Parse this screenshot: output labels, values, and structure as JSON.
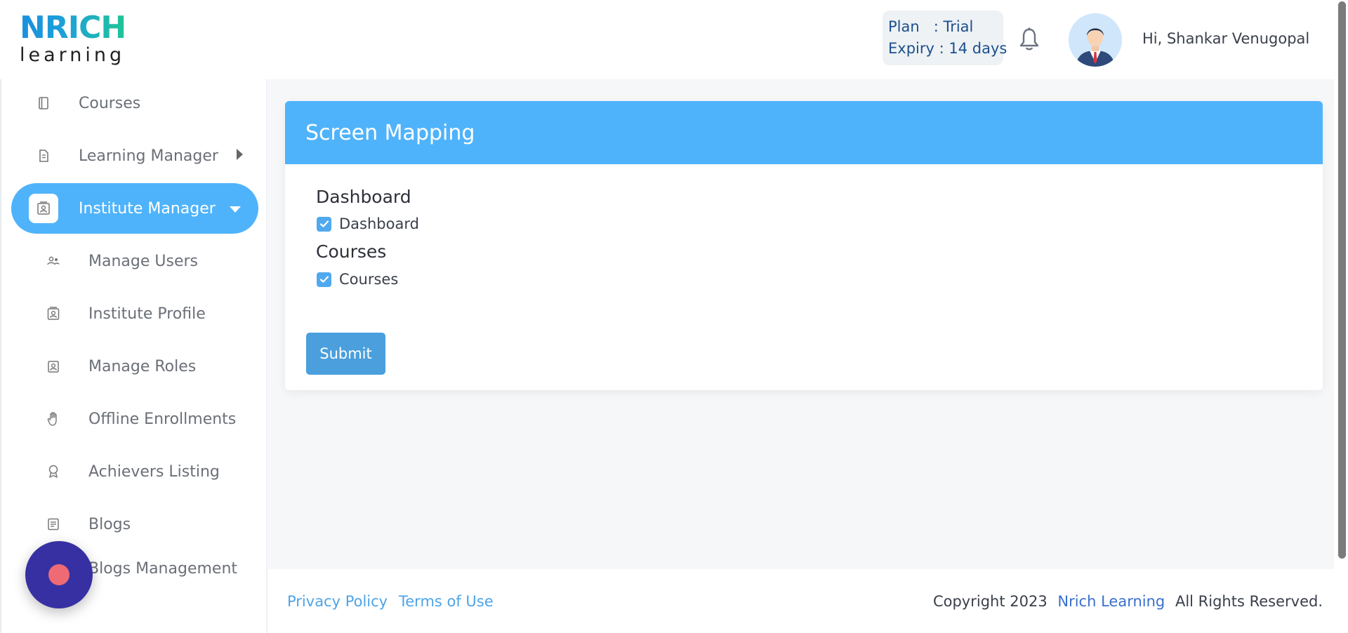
{
  "header": {
    "logo_top": "NRICH",
    "logo_bottom": "learning",
    "plan_label": "Plan   : Trial",
    "expiry_label": "Expiry : 14 days",
    "greeting": "Hi, Shankar Venugopal"
  },
  "sidebar": {
    "items": [
      {
        "label": "Courses",
        "icon": "book-icon"
      },
      {
        "label": "Learning Manager",
        "icon": "document-icon"
      },
      {
        "label": "Institute Manager",
        "icon": "id-card-icon"
      },
      {
        "label": "Manage Users",
        "icon": "users-icon"
      },
      {
        "label": "Institute Profile",
        "icon": "profile-icon"
      },
      {
        "label": "Manage Roles",
        "icon": "role-icon"
      },
      {
        "label": "Offline Enrollments",
        "icon": "hand-icon"
      },
      {
        "label": "Achievers Listing",
        "icon": "award-icon"
      },
      {
        "label": "Blogs",
        "icon": "blog-icon"
      },
      {
        "label": "Blogs Management",
        "icon": "blog-manage-icon"
      }
    ]
  },
  "main": {
    "card_title": "Screen Mapping",
    "groups": [
      {
        "title": "Dashboard",
        "option": "Dashboard",
        "checked": true
      },
      {
        "title": "Courses",
        "option": "Courses",
        "checked": true
      }
    ],
    "submit_label": "Submit"
  },
  "footer": {
    "privacy": "Privacy Policy",
    "terms": "Terms of Use",
    "copyright_prefix": "Copyright 2023",
    "brand": "Nrich Learning",
    "copyright_suffix": "All Rights Reserved."
  },
  "colors": {
    "accent": "#4fb3fb",
    "button": "#4a9fdc",
    "fab": "#3730a3",
    "fab_dot": "#ee6b75"
  }
}
